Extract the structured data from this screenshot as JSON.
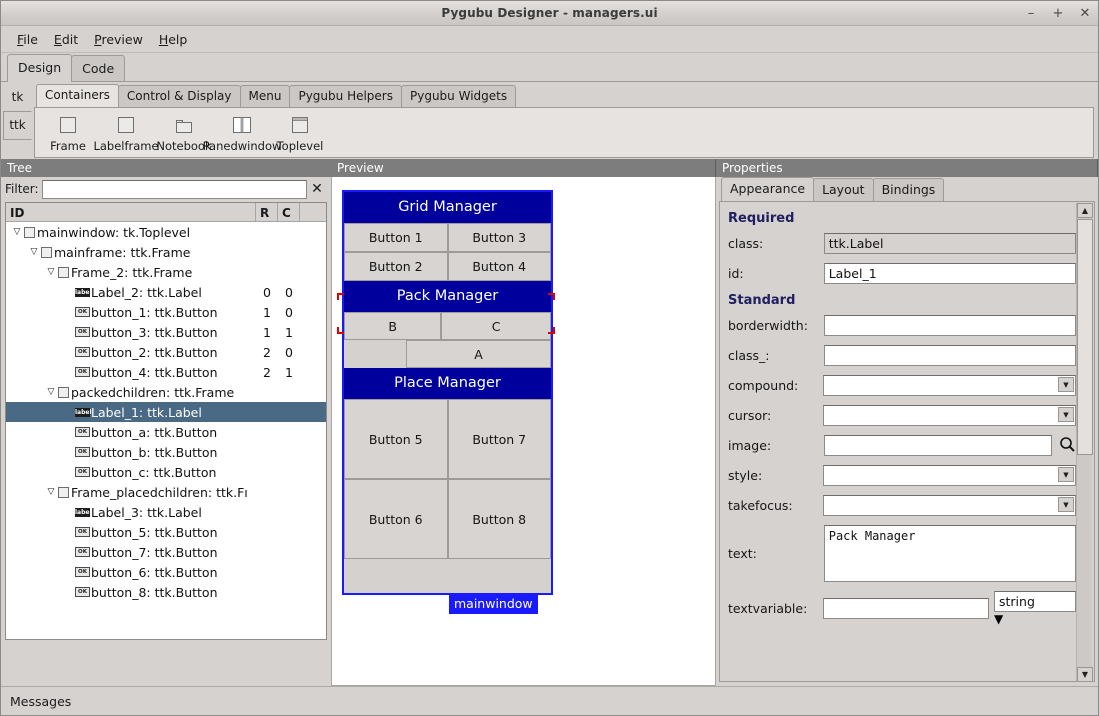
{
  "window": {
    "title": "Pygubu Designer - managers.ui",
    "minimize": "–",
    "maximize": "+",
    "close": "✕"
  },
  "menubar": {
    "items": [
      {
        "acc": "F",
        "rest": "ile"
      },
      {
        "acc": "E",
        "rest": "dit"
      },
      {
        "acc": "P",
        "rest": "review"
      },
      {
        "acc": "H",
        "rest": "elp"
      }
    ]
  },
  "main_tabs": {
    "items": [
      {
        "label": "Design",
        "selected": true
      },
      {
        "label": "Code",
        "selected": false
      }
    ]
  },
  "palette": {
    "side_tabs": [
      {
        "label": "tk",
        "selected": false
      },
      {
        "label": "ttk",
        "selected": true
      }
    ],
    "group_tabs": [
      {
        "label": "Containers",
        "selected": true
      },
      {
        "label": "Control & Display",
        "selected": false
      },
      {
        "label": "Menu",
        "selected": false
      },
      {
        "label": "Pygubu Helpers",
        "selected": false
      },
      {
        "label": "Pygubu Widgets",
        "selected": false
      }
    ],
    "widgets": [
      {
        "label": "Frame",
        "icon": "frame-icon"
      },
      {
        "label": "Labelframe",
        "icon": "labelframe-icon"
      },
      {
        "label": "Notebook",
        "icon": "notebook-icon"
      },
      {
        "label": "Panedwindow",
        "icon": "panedwindow-icon"
      },
      {
        "label": "Toplevel",
        "icon": "toplevel-icon"
      }
    ]
  },
  "tree_pane": {
    "title": "Tree",
    "filter_label": "Filter:",
    "filter_value": "",
    "filter_placeholder": "",
    "clear_icon": "✕",
    "columns": {
      "id": "ID",
      "r": "R",
      "c": "C"
    },
    "rows": [
      {
        "indent": 0,
        "twisty": "open",
        "icon": "frame",
        "label": "mainwindow: tk.Toplevel",
        "r": "",
        "c": "",
        "selected": false
      },
      {
        "indent": 1,
        "twisty": "open",
        "icon": "frame",
        "label": "mainframe: ttk.Frame",
        "r": "",
        "c": "",
        "selected": false
      },
      {
        "indent": 2,
        "twisty": "open",
        "icon": "frame",
        "label": "Frame_2: ttk.Frame",
        "r": "",
        "c": "",
        "selected": false
      },
      {
        "indent": 3,
        "twisty": "none",
        "icon": "label",
        "label": "Label_2: ttk.Label",
        "r": "0",
        "c": "0",
        "selected": false
      },
      {
        "indent": 3,
        "twisty": "none",
        "icon": "button",
        "label": "button_1: ttk.Button",
        "r": "1",
        "c": "0",
        "selected": false
      },
      {
        "indent": 3,
        "twisty": "none",
        "icon": "button",
        "label": "button_3: ttk.Button",
        "r": "1",
        "c": "1",
        "selected": false
      },
      {
        "indent": 3,
        "twisty": "none",
        "icon": "button",
        "label": "button_2: ttk.Button",
        "r": "2",
        "c": "0",
        "selected": false
      },
      {
        "indent": 3,
        "twisty": "none",
        "icon": "button",
        "label": "button_4: ttk.Button",
        "r": "2",
        "c": "1",
        "selected": false
      },
      {
        "indent": 2,
        "twisty": "open",
        "icon": "frame",
        "label": "packedchildren: ttk.Frame",
        "r": "",
        "c": "",
        "selected": false
      },
      {
        "indent": 3,
        "twisty": "none",
        "icon": "label",
        "label": "Label_1: ttk.Label",
        "r": "",
        "c": "",
        "selected": true
      },
      {
        "indent": 3,
        "twisty": "none",
        "icon": "button",
        "label": "button_a: ttk.Button",
        "r": "",
        "c": "",
        "selected": false
      },
      {
        "indent": 3,
        "twisty": "none",
        "icon": "button",
        "label": "button_b: ttk.Button",
        "r": "",
        "c": "",
        "selected": false
      },
      {
        "indent": 3,
        "twisty": "none",
        "icon": "button",
        "label": "button_c: ttk.Button",
        "r": "",
        "c": "",
        "selected": false
      },
      {
        "indent": 2,
        "twisty": "open",
        "icon": "frame",
        "label": "Frame_placedchildren: ttk.Fı",
        "r": "",
        "c": "",
        "selected": false
      },
      {
        "indent": 3,
        "twisty": "none",
        "icon": "label",
        "label": "Label_3: ttk.Label",
        "r": "",
        "c": "",
        "selected": false
      },
      {
        "indent": 3,
        "twisty": "none",
        "icon": "button",
        "label": "button_5: ttk.Button",
        "r": "",
        "c": "",
        "selected": false
      },
      {
        "indent": 3,
        "twisty": "none",
        "icon": "button",
        "label": "button_7: ttk.Button",
        "r": "",
        "c": "",
        "selected": false
      },
      {
        "indent": 3,
        "twisty": "none",
        "icon": "button",
        "label": "button_6: ttk.Button",
        "r": "",
        "c": "",
        "selected": false
      },
      {
        "indent": 3,
        "twisty": "none",
        "icon": "button",
        "label": "button_8: ttk.Button",
        "r": "",
        "c": "",
        "selected": false
      }
    ]
  },
  "preview_pane": {
    "title": "Preview",
    "window_tag": "mainwindow",
    "sections": [
      {
        "title": "Grid Manager",
        "buttons": [
          "Button 1",
          "Button 3",
          "Button 2",
          "Button 4"
        ]
      },
      {
        "title": "Pack Manager",
        "buttons": [
          "B",
          "C",
          "A"
        ]
      },
      {
        "title": "Place Manager",
        "buttons": [
          "Button 5",
          "Button 7",
          "Button 6",
          "Button 8"
        ]
      }
    ]
  },
  "properties_pane": {
    "title": "Properties",
    "tabs": [
      {
        "label": "Appearance",
        "selected": true
      },
      {
        "label": "Layout",
        "selected": false
      },
      {
        "label": "Bindings",
        "selected": false
      }
    ],
    "section_required": "Required",
    "section_standard": "Standard",
    "fields": {
      "class_label": "class:",
      "class_value": "ttk.Label",
      "id_label": "id:",
      "id_value": "Label_1",
      "borderwidth_label": "borderwidth:",
      "borderwidth_value": "",
      "class_u_label": "class_:",
      "class_u_value": "",
      "compound_label": "compound:",
      "compound_value": "",
      "cursor_label": "cursor:",
      "cursor_value": "",
      "image_label": "image:",
      "image_value": "",
      "style_label": "style:",
      "style_value": "",
      "takefocus_label": "takefocus:",
      "takefocus_value": "",
      "text_label": "text:",
      "text_value": "Pack Manager",
      "textvariable_label": "textvariable:",
      "textvariable_value": "",
      "textvariable_type": "string"
    }
  },
  "statusbar": {
    "label": "Messages"
  },
  "colors": {
    "accent_blue": "#00009c",
    "selection": "#4a6984",
    "tag_blue": "#1a1aff",
    "handle_red": "#e00000",
    "pane_header": "#7d7d7d",
    "section_heading": "#202060"
  }
}
